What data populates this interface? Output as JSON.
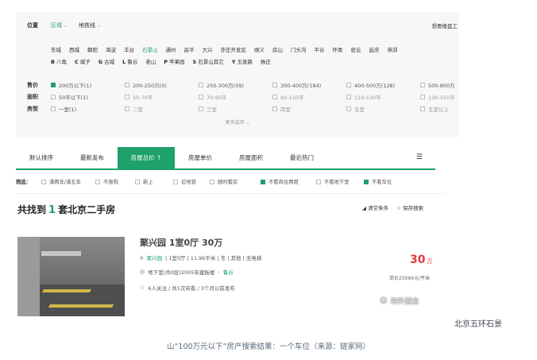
{
  "filter": {
    "location_label": "位置",
    "location_tabs": [
      "区域",
      "地铁线"
    ],
    "want_link": "想要楼盘工",
    "districts_row1": [
      "东城",
      "西城",
      "朝阳",
      "海淀",
      "丰台",
      "石景山",
      "通州",
      "昌平",
      "大兴",
      "亦庄开发区",
      "顺义",
      "房山",
      "门头沟",
      "平谷",
      "怀柔",
      "密云",
      "延庆",
      "燕郊"
    ],
    "districts_row2": [
      {
        "letter": "B",
        "name": "八角"
      },
      {
        "letter": "C",
        "name": "城子"
      },
      {
        "letter": "G",
        "name": "古城"
      },
      {
        "letter": "L",
        "name": "鲁谷"
      },
      {
        "letter": "",
        "name": "老山"
      },
      {
        "letter": "P",
        "name": "苹果园"
      },
      {
        "letter": "S",
        "name": "石景山其它"
      },
      {
        "letter": "Y",
        "name": "玉泉路"
      },
      {
        "letter": "",
        "name": "杨庄"
      }
    ],
    "price_label": "售价",
    "price_options": [
      "200万以下(1)",
      "200-250万(0)",
      "250-300万(59)",
      "300-400万(184)",
      "400-500万(128)",
      "500-800万"
    ],
    "area_label": "面积",
    "area_options": [
      "50平以下(1)",
      "50-70平",
      "70-90平",
      "90-110平",
      "110-130平",
      "130-150平"
    ],
    "rooms_label": "房型",
    "rooms_options": [
      "一室(1)",
      "二室",
      "三室",
      "四室",
      "五室",
      "五室以上"
    ],
    "more": "更多选项 ⌄"
  },
  "sort": {
    "tabs": [
      "默认排序",
      "最新发布",
      "房屋总价 ↑",
      "房屋单价",
      "房屋面积",
      "最近热门"
    ],
    "active_index": 2
  },
  "screen": {
    "label": "筛选：",
    "items": [
      {
        "text": "满两年/满五年",
        "checked": false
      },
      {
        "text": "不限购",
        "checked": false
      },
      {
        "text": "新上",
        "checked": false
      },
      {
        "text": "近地铁",
        "checked": false
      },
      {
        "text": "随时看房",
        "checked": false
      },
      {
        "text": "不看商住两用",
        "checked": true
      },
      {
        "text": "不看地下室",
        "checked": false
      },
      {
        "text": "不看车位",
        "checked": true
      }
    ]
  },
  "result": {
    "prefix": "共找到",
    "count": "1",
    "suffix": "套北京二手房",
    "clear": "清空条件",
    "save": "保存搜索"
  },
  "listing": {
    "title": "聚兴园 1室0厅 30万",
    "community": "聚兴园",
    "details": "| 1室0厅 | 11.96平米 | 东 | 其他 | 无电梯",
    "floor": "地下室(共0层)2005年建板楼",
    "area_name": "鲁谷",
    "follow": "6人关注 / 共1次带看 / 3个月以前发布",
    "price": "30",
    "price_unit": "万",
    "unit_price": "单价25084元/平米"
  },
  "watermark": "海外掘金",
  "place_label": "北京五环石景",
  "caption": "山“100万元以下”房产搜索结果：一个车位（来源：链家网）",
  "colors": {
    "accent": "#1ea16a",
    "price": "#e4393c"
  }
}
